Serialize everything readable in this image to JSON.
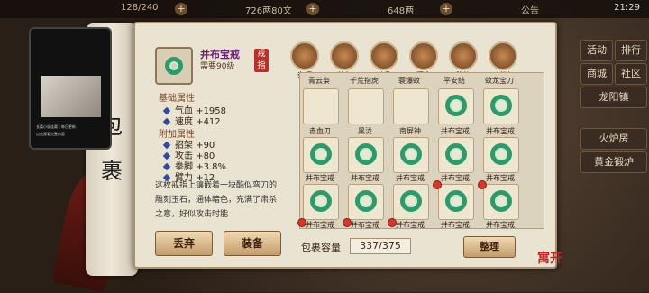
{
  "topbar": {
    "left_text": "128/240",
    "center_text": "726两80文",
    "gold_text": "648两",
    "announcement": "公告",
    "time": "21:29"
  },
  "side_scroll": {
    "chars": [
      "包",
      "裹"
    ]
  },
  "phone_overlay": {
    "caption": "长篇小说连载 | 每日更新",
    "sub": "点击观看完整内容"
  },
  "item": {
    "name": "并布宝戒",
    "requirement": "需要90级",
    "type_seal": "戒指",
    "base_title": "基础属性",
    "base_stats": [
      {
        "label": "气血",
        "value": "+1958"
      },
      {
        "label": "速度",
        "value": "+412"
      }
    ],
    "extra_title": "附加属性",
    "extra_stats": [
      {
        "label": "招架",
        "value": "+90"
      },
      {
        "label": "攻击",
        "value": "+80"
      },
      {
        "label": "拳脚",
        "value": "+3.8%"
      },
      {
        "label": "臂力",
        "value": "+12"
      }
    ],
    "description": "这枚戒指上镶嵌着一块酷似弯刀的雕刻玉石，通体暗色，充满了肃杀之意，好似攻击时能"
  },
  "buttons": {
    "discard": "丢弃",
    "equip": "装备",
    "sort": "整理"
  },
  "tabs": [
    "杂项",
    "装备",
    "药品",
    "酒食",
    "秘籍",
    "材料"
  ],
  "grid_top_labels": [
    "青云枭",
    "千荒指虎",
    "蓑爆蚊",
    "平安结",
    "蚊龙宝刀"
  ],
  "grid_rows": [
    [
      "赤血刃",
      "黑泷",
      "南屏钟",
      "并布宝戒",
      "并布宝戒"
    ],
    [
      "并布宝戒",
      "并布宝戒",
      "并布宝戒",
      "并布宝戒",
      "并布宝戒"
    ],
    [
      "并布宝戒",
      "并布宝戒",
      "并布宝戒",
      "并布宝戒",
      "并布宝戒"
    ],
    [
      "",
      "",
      "",
      "",
      ""
    ]
  ],
  "capacity": {
    "label": "包裹容量",
    "value": "337/375"
  },
  "right_menu": [
    "活动",
    "排行",
    "商城",
    "社区",
    "龙阳镇",
    "火炉房",
    "黄金锻炉"
  ],
  "logo": "寓开",
  "colors": {
    "ring": "#2c9a6b",
    "name": "#6d1a7c",
    "seal": "#b8322a"
  }
}
